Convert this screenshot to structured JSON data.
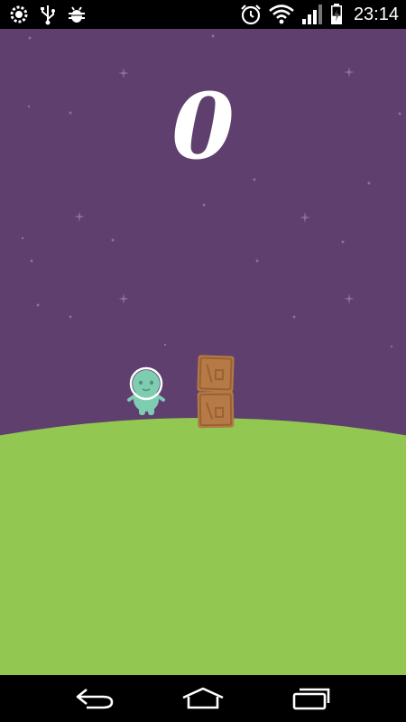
{
  "status_bar": {
    "time": "23:14",
    "left_icons": [
      "settings-icon",
      "usb-icon",
      "debug-bug-icon"
    ],
    "right_icons": [
      "alarm-icon",
      "wifi-icon",
      "signal-icon",
      "battery-charging-icon"
    ]
  },
  "game": {
    "score": "0",
    "colors": {
      "sky": "#5e3f6d",
      "ground": "#92c751",
      "alien": "#7ecdb0",
      "crate": "#b57a45",
      "stars": "#8e6ea6"
    },
    "player": "alien-astronaut",
    "obstacles": [
      "crate",
      "crate"
    ]
  },
  "nav_bar": {
    "buttons": [
      "back-icon",
      "home-icon",
      "recent-apps-icon"
    ]
  }
}
